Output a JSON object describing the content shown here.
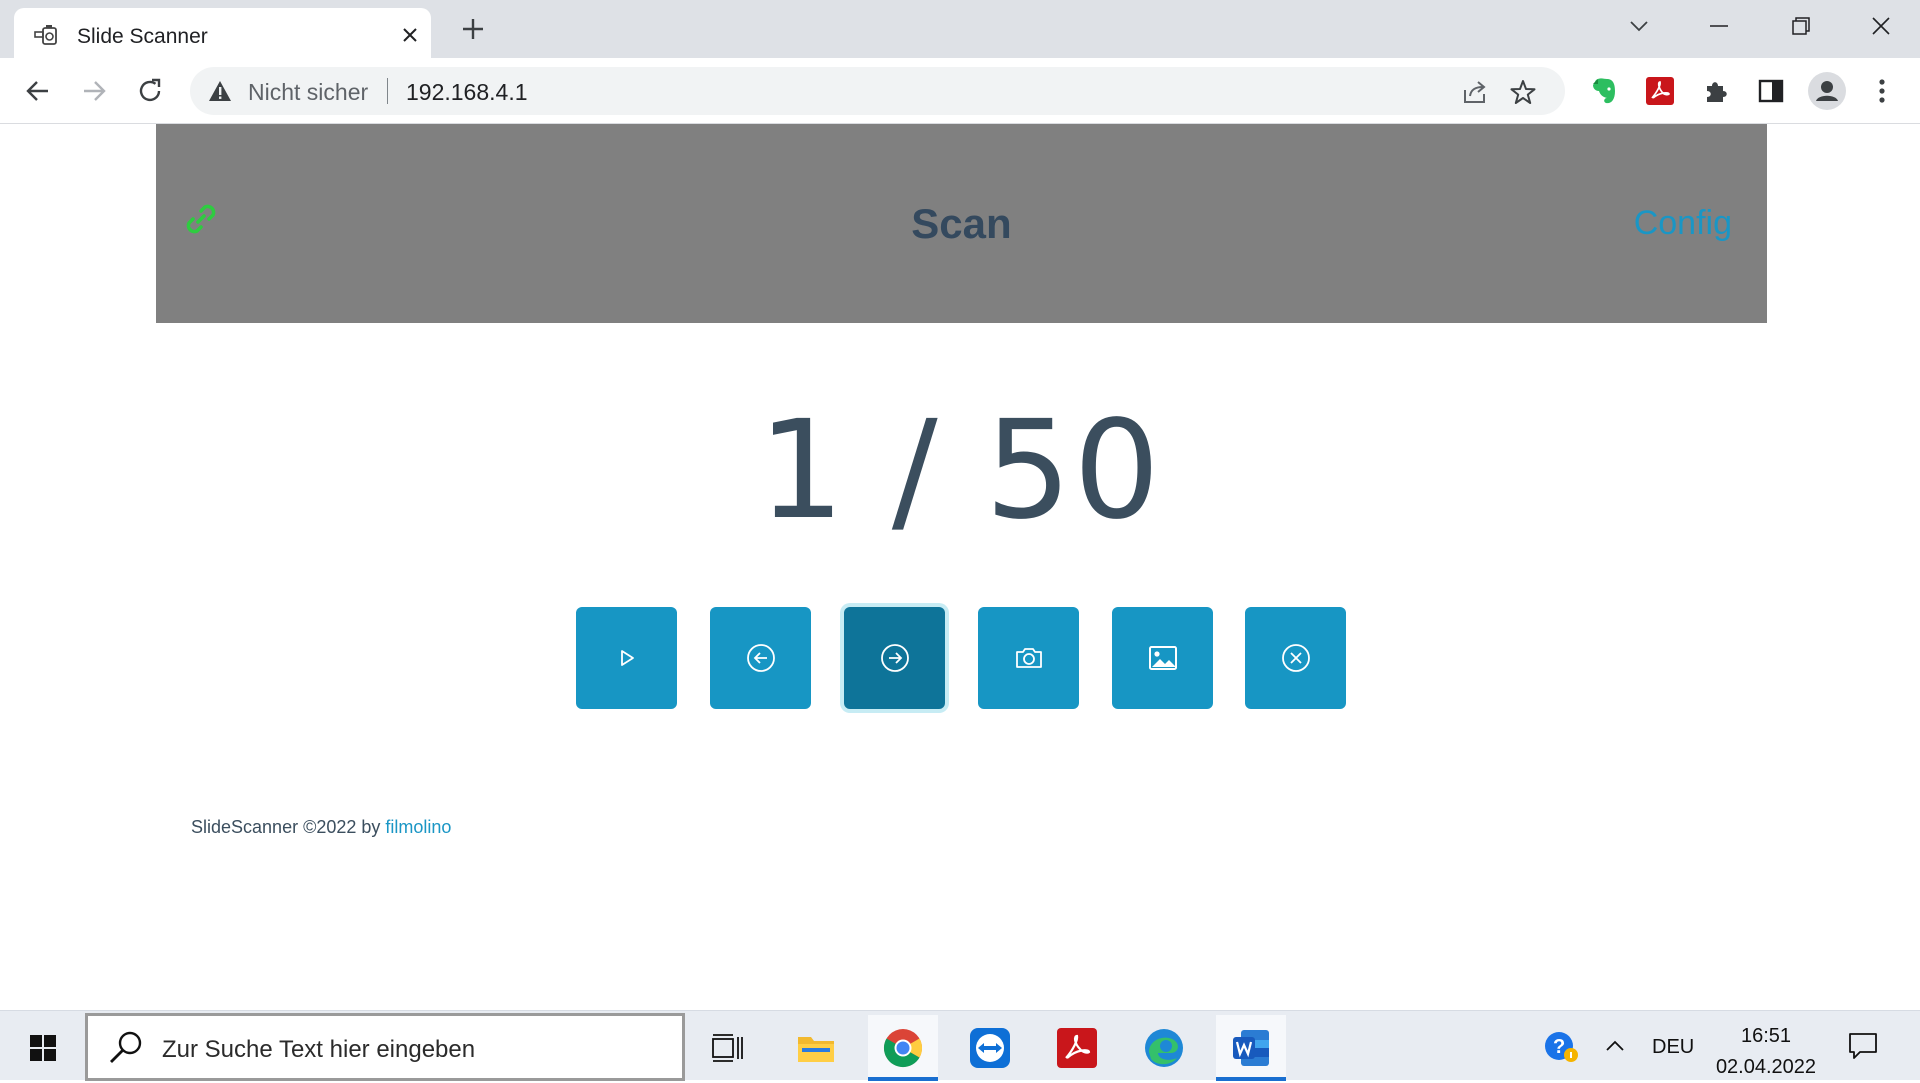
{
  "browser": {
    "tab_title": "Slide Scanner",
    "omnibox": {
      "security_label": "Nicht sicher",
      "url": "192.168.4.1"
    }
  },
  "page": {
    "title": "Scan",
    "config_label": "Config",
    "counter": "1 / 50",
    "controls": [
      {
        "name": "play",
        "icon": "play-icon",
        "active": false
      },
      {
        "name": "previous",
        "icon": "arrow-left-circle-icon",
        "active": false
      },
      {
        "name": "next",
        "icon": "arrow-right-circle-icon",
        "active": true
      },
      {
        "name": "capture",
        "icon": "camera-icon",
        "active": false
      },
      {
        "name": "image",
        "icon": "image-icon",
        "active": false
      },
      {
        "name": "cancel",
        "icon": "close-circle-icon",
        "active": false
      }
    ],
    "footer": {
      "text": "SlideScanner ©2022 by ",
      "link": "filmolino"
    }
  },
  "taskbar": {
    "search_placeholder": "Zur Suche Text hier eingeben",
    "language": "DEU",
    "time": "16:51",
    "date": "02.04.2022"
  },
  "colors": {
    "header_bg": "#808080",
    "button_bg": "#1796c4",
    "button_active_bg": "#0e7499",
    "link": "#1a96c5",
    "title": "#34495e",
    "link_icon": "#2ecc40"
  }
}
